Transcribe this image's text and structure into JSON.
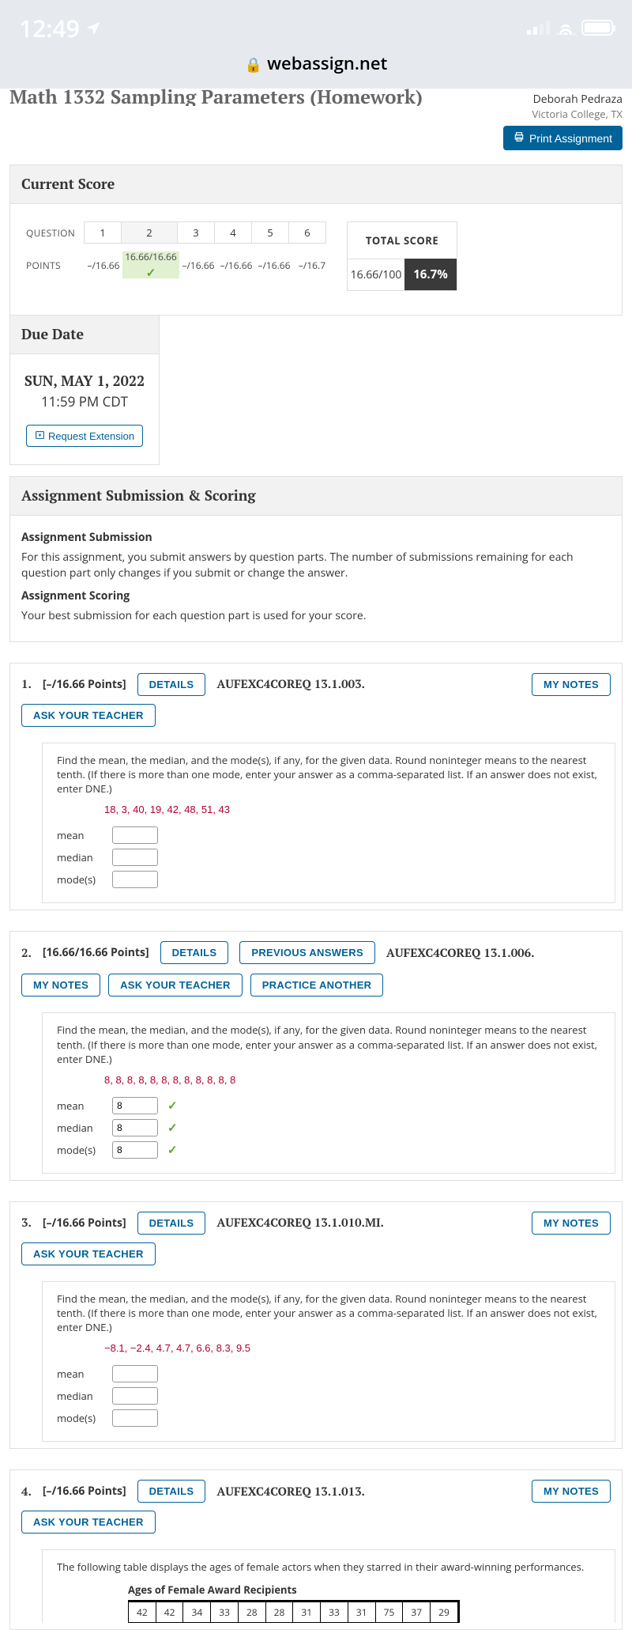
{
  "status": {
    "time": "12:49",
    "url": "webassign.net"
  },
  "page_title": "Math 1332 Sampling Parameters (Homework)",
  "user": {
    "name": "Deborah Pedraza",
    "school": "Victoria College, TX"
  },
  "print_label": "Print Assignment",
  "current_score": {
    "header": "Current Score",
    "question_label": "QUESTION",
    "points_label": "POINTS",
    "questions": [
      "1",
      "2",
      "3",
      "4",
      "5",
      "6"
    ],
    "points": [
      "–/16.66",
      "16.66/16.66",
      "–/16.66",
      "–/16.66",
      "–/16.66",
      "–/16.7"
    ],
    "active_q_index": 1,
    "total_label": "TOTAL SCORE",
    "total_frac": "16.66/100",
    "total_pct": "16.7%"
  },
  "due": {
    "header": "Due Date",
    "date": "SUN, MAY 1, 2022",
    "time": "11:59 PM CDT",
    "request_label": "Request Extension"
  },
  "submission": {
    "header": "Assignment Submission & Scoring",
    "sub1_title": "Assignment Submission",
    "sub1_text": "For this assignment, you submit answers by question parts. The number of submissions remaining for each question part only changes if you submit or change the answer.",
    "sub2_title": "Assignment Scoring",
    "sub2_text": "Your best submission for each question part is used for your score."
  },
  "buttons": {
    "details": "DETAILS",
    "my_notes": "MY NOTES",
    "ask": "ASK YOUR TEACHER",
    "previous": "PREVIOUS ANSWERS",
    "practice": "PRACTICE ANOTHER"
  },
  "labels": {
    "mean": "mean",
    "median": "median",
    "modes": "mode(s)"
  },
  "q1": {
    "num": "1.",
    "points": "[–/16.66 Points]",
    "code": "AUFEXC4COREQ 13.1.003.",
    "instr": "Find the mean, the median, and the mode(s), if any, for the given data. Round noninteger means to the nearest tenth. (If there is more than one mode, enter your answer as a comma-separated list. If an answer does not exist, enter DNE.)",
    "data": "18, 3, 40, 19, 42, 48, 51, 43"
  },
  "q2": {
    "num": "2.",
    "points": "[16.66/16.66 Points]",
    "code": "AUFEXC4COREQ 13.1.006.",
    "instr": "Find the mean, the median, and the mode(s), if any, for the given data. Round noninteger means to the nearest tenth. (If there is more than one mode, enter your answer as a comma-separated list. If an answer does not exist, enter DNE.)",
    "data": "8, 8, 8, 8, 8, 8, 8, 8, 8, 8, 8, 8",
    "mean": "8",
    "median": "8",
    "modes": "8"
  },
  "q3": {
    "num": "3.",
    "points": "[–/16.66 Points]",
    "code": "AUFEXC4COREQ 13.1.010.MI.",
    "instr": "Find the mean, the median, and the mode(s), if any, for the given data. Round noninteger means to the nearest tenth. (If there is more than one mode, enter your answer as a comma-separated list. If an answer does not exist, enter DNE.)",
    "data": "−8.1, −2.4, 4.7, 4.7, 6.6, 8.3, 9.5"
  },
  "q4": {
    "num": "4.",
    "points": "[–/16.66 Points]",
    "code": "AUFEXC4COREQ 13.1.013.",
    "instr": "The following table displays the ages of female actors when they starred in their award-winning performances.",
    "table_title": "Ages of Female Award Recipients",
    "ages": [
      "42",
      "42",
      "34",
      "33",
      "28",
      "28",
      "31",
      "33",
      "31",
      "75",
      "37",
      "29"
    ]
  }
}
